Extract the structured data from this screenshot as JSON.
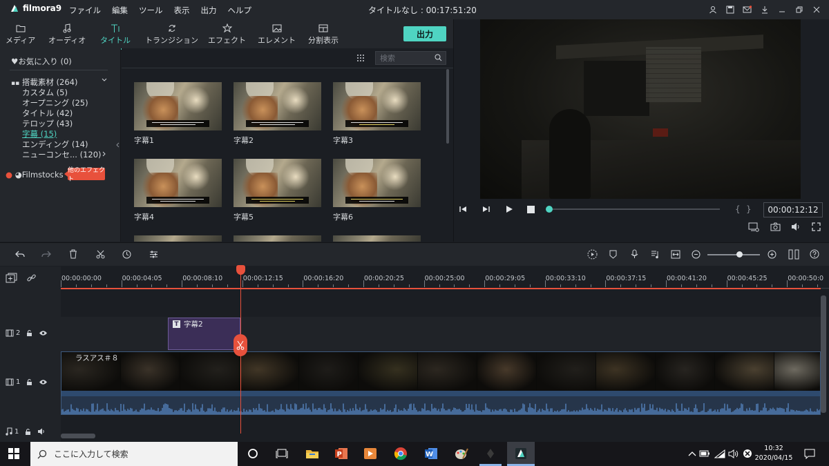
{
  "app": {
    "name": "filmora9",
    "menu": [
      "ファイル",
      "編集",
      "ツール",
      "表示",
      "出力",
      "ヘルプ"
    ],
    "title": "タイトルなし : 00:17:51:20"
  },
  "library": {
    "tabs": [
      {
        "label": "メディア",
        "icon": "folder-icon"
      },
      {
        "label": "オーディオ",
        "icon": "music-note-icon"
      },
      {
        "label": "タイトル",
        "icon": "title-text-icon",
        "active": true
      },
      {
        "label": "トランジション",
        "icon": "transition-icon"
      },
      {
        "label": "エフェクト",
        "icon": "effects-icon"
      },
      {
        "label": "エレメント",
        "icon": "image-icon"
      },
      {
        "label": "分割表示",
        "icon": "split-screen-icon"
      }
    ],
    "export_label": "出力",
    "search_placeholder": "検索",
    "sidebar": {
      "favorites": "お気に入り (0)",
      "builtin": "搭載素材 (264)",
      "items": [
        "カスタム (5)",
        "オープニング (25)",
        "タイトル (42)",
        "テロップ (43)",
        "字幕 (15)",
        "エンディング (14)",
        "ニューコンセ... (120)"
      ],
      "selected_index": 4,
      "filmstocks": "Filmstocks",
      "more_effects": "他のエフェクト"
    },
    "thumbnails": [
      "字幕1",
      "字幕2",
      "字幕3",
      "字幕4",
      "字幕5",
      "字幕6"
    ]
  },
  "preview": {
    "timecode": "00:00:12:12",
    "progress": 0.01
  },
  "timeline": {
    "ruler": [
      "00:00:00:00",
      "00:00:04:05",
      "00:00:08:10",
      "00:00:12:15",
      "00:00:16:20",
      "00:00:20:25",
      "00:00:25:00",
      "00:00:29:05",
      "00:00:33:10",
      "00:00:37:15",
      "00:00:41:20",
      "00:00:45:25",
      "00:00:50:0"
    ],
    "tracks": [
      {
        "label": "2"
      },
      {
        "label": "1"
      },
      {
        "label": "1"
      }
    ],
    "title_clip": "字幕2",
    "video_clip": "ラスアス＃８",
    "zoom": 0.55
  },
  "taskbar": {
    "search_placeholder": "ここに入力して検索",
    "time": "10:32",
    "date": "2020/04/15"
  },
  "colors": {
    "accent": "#4fd4c2",
    "playhead": "#e8513c",
    "title_clip": "#3b2e57",
    "video_clip": "#26354a"
  }
}
